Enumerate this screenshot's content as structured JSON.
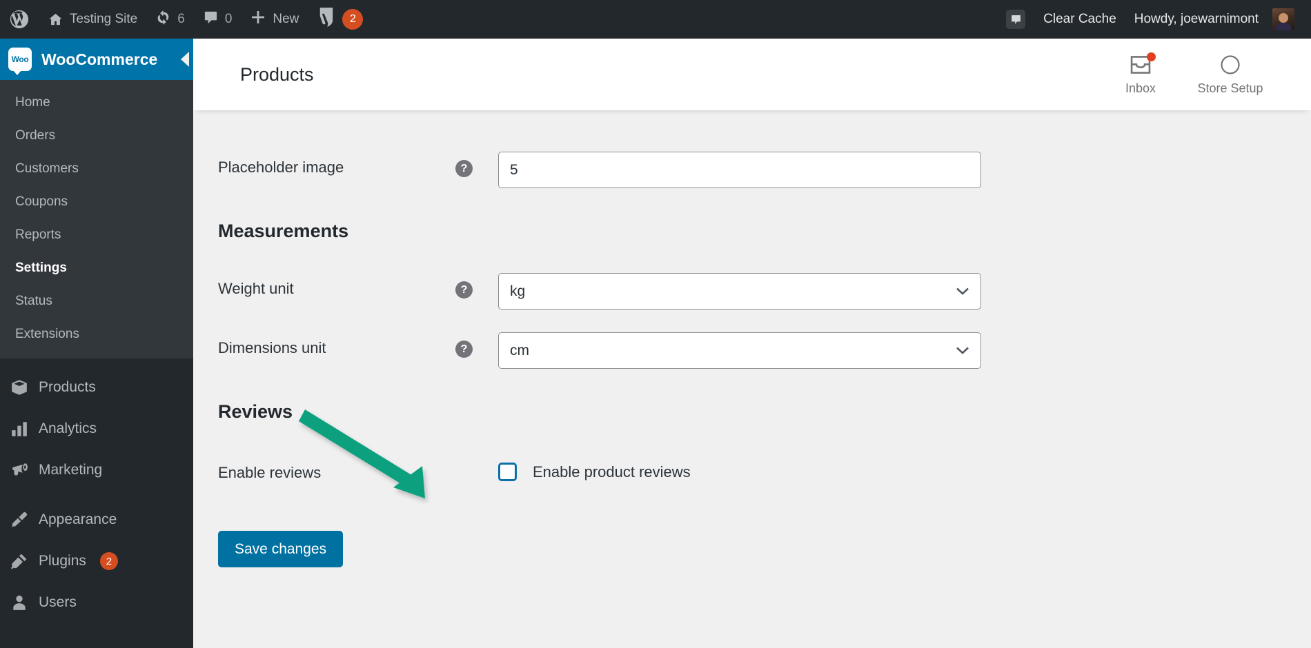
{
  "adminbar": {
    "site_name": "Testing Site",
    "updates_count": "6",
    "comments_count": "0",
    "new_label": "New",
    "yoast_count": "2",
    "clear_cache_label": "Clear Cache",
    "howdy_label": "Howdy, joewarnimont",
    "icons": {
      "wordpress": "wordpress-logo-icon",
      "home": "home-icon",
      "updates": "updates-icon",
      "comments": "comment-icon",
      "new": "plus-icon",
      "yoast": "yoast-seo-icon",
      "cache": "speech-bubble-icon",
      "avatar": "user-avatar"
    }
  },
  "sidebar": {
    "brand": {
      "label": "WooCommerce",
      "mark_text": "Woo"
    },
    "submenu": [
      {
        "label": "Home",
        "current": false
      },
      {
        "label": "Orders",
        "current": false
      },
      {
        "label": "Customers",
        "current": false
      },
      {
        "label": "Coupons",
        "current": false
      },
      {
        "label": "Reports",
        "current": false
      },
      {
        "label": "Settings",
        "current": true
      },
      {
        "label": "Status",
        "current": false
      },
      {
        "label": "Extensions",
        "current": false
      }
    ],
    "items": [
      {
        "label": "Products",
        "icon": "box-icon",
        "badge": ""
      },
      {
        "label": "Analytics",
        "icon": "bar-chart-icon",
        "badge": ""
      },
      {
        "label": "Marketing",
        "icon": "megaphone-icon",
        "badge": ""
      },
      {
        "label": "Appearance",
        "icon": "paintbrush-icon",
        "badge": ""
      },
      {
        "label": "Plugins",
        "icon": "plug-icon",
        "badge": "2"
      },
      {
        "label": "Users",
        "icon": "user-icon",
        "badge": ""
      }
    ]
  },
  "header": {
    "title": "Products",
    "actions": [
      {
        "label": "Inbox",
        "icon": "inbox-icon",
        "has_dot": true
      },
      {
        "label": "Store Setup",
        "icon": "circle-progress-icon",
        "has_dot": false
      }
    ]
  },
  "form": {
    "placeholder_image": {
      "label": "Placeholder image",
      "value": "5",
      "help": "?"
    },
    "measurements_heading": "Measurements",
    "weight_unit": {
      "label": "Weight unit",
      "value": "kg",
      "help": "?"
    },
    "dimensions_unit": {
      "label": "Dimensions unit",
      "value": "cm",
      "help": "?"
    },
    "reviews_heading": "Reviews",
    "enable_reviews": {
      "label": "Enable reviews",
      "checkbox_label": "Enable product reviews",
      "checked": false
    },
    "save_label": "Save changes"
  },
  "annotation": {
    "type": "arrow",
    "color": "#0fa07e",
    "points_to": "enable-product-reviews-checkbox"
  },
  "colors": {
    "adminbar_bg": "#23282d",
    "sidebar_bg": "#23282d",
    "submenu_bg": "#32373c",
    "woo_blue": "#0073a8",
    "button_blue": "#0071a1",
    "badge_orange": "#d54e21",
    "accent_red": "#e2401c",
    "content_bg": "#f0f0f1",
    "annotation_green": "#0fa07e"
  }
}
